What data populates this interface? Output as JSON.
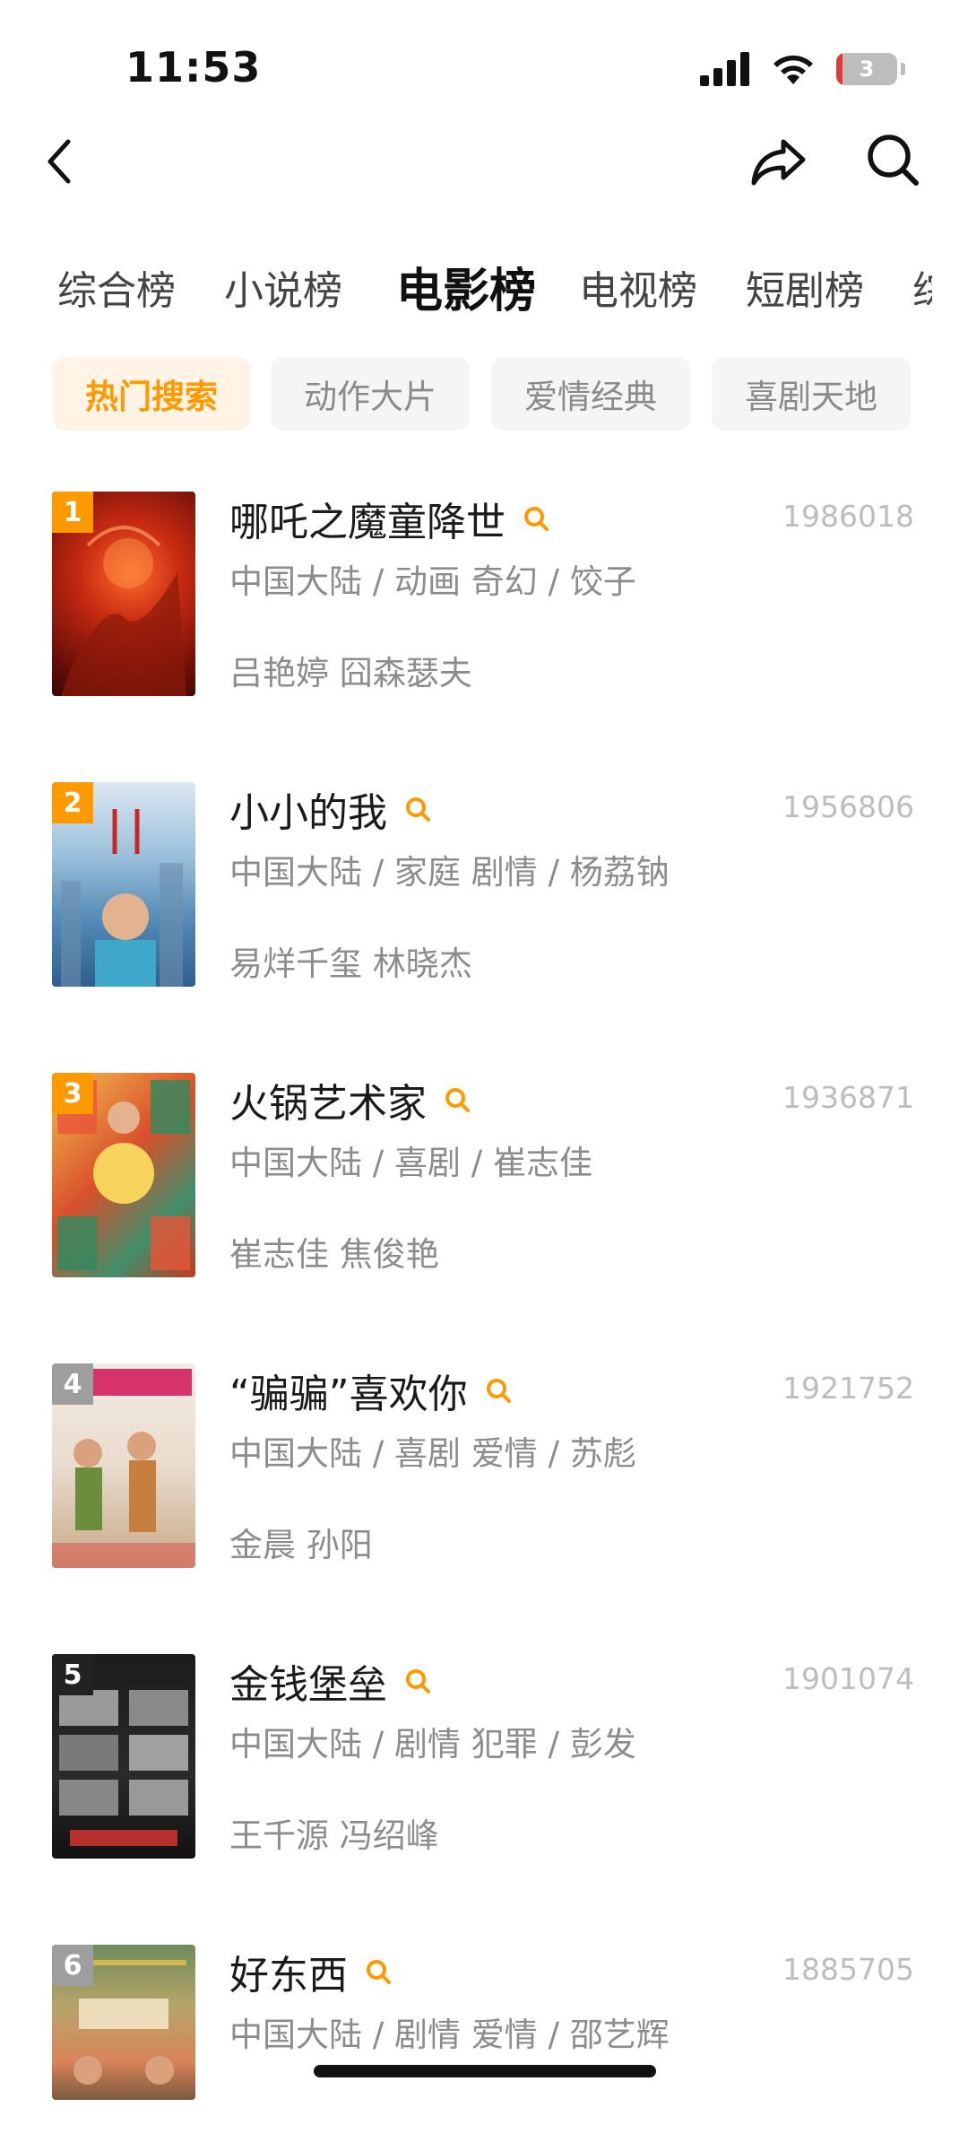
{
  "status_bar": {
    "time": "11:53",
    "battery_level": "3",
    "icons": [
      "signal-icon",
      "wifi-icon",
      "battery-icon"
    ]
  },
  "nav": {
    "icons": [
      "back-icon",
      "share-icon",
      "search-icon"
    ]
  },
  "main_tabs": [
    {
      "label": "综合榜",
      "active": false
    },
    {
      "label": "小说榜",
      "active": false
    },
    {
      "label": "电影榜",
      "active": true
    },
    {
      "label": "电视榜",
      "active": false
    },
    {
      "label": "短剧榜",
      "active": false
    },
    {
      "label": "综",
      "active": false
    }
  ],
  "sub_tabs": [
    {
      "label": "热门搜索",
      "active": true
    },
    {
      "label": "动作大片",
      "active": false
    },
    {
      "label": "爱情经典",
      "active": false
    },
    {
      "label": "喜剧天地",
      "active": false
    }
  ],
  "colors": {
    "accent": "#ff9900",
    "rank_top3": "#ff9900",
    "rank_other": "#9e9e9e",
    "rank_5": "#222222"
  },
  "movies": [
    {
      "rank": "1",
      "title": "哪吒之魔童降世",
      "score": "1986018",
      "meta": "中国大陆 / 动画 奇幻 / 饺子",
      "cast": "吕艳婷 囧森瑟夫"
    },
    {
      "rank": "2",
      "title": "小小的我",
      "score": "1956806",
      "meta": "中国大陆 / 家庭 剧情 / 杨荔钠",
      "cast": "易烊千玺 林晓杰"
    },
    {
      "rank": "3",
      "title": "火锅艺术家",
      "score": "1936871",
      "meta": "中国大陆 / 喜剧 / 崔志佳",
      "cast": "崔志佳 焦俊艳"
    },
    {
      "rank": "4",
      "title": "“骗骗”喜欢你",
      "score": "1921752",
      "meta": "中国大陆 / 喜剧 爱情 / 苏彪",
      "cast": "金晨 孙阳"
    },
    {
      "rank": "5",
      "title": "金钱堡垒",
      "score": "1901074",
      "meta": "中国大陆 / 剧情 犯罪 / 彭发",
      "cast": "王千源 冯绍峰"
    },
    {
      "rank": "6",
      "title": "好东西",
      "score": "1885705",
      "meta": "中国大陆 / 剧情 爱情 / 邵艺辉",
      "cast": ""
    }
  ]
}
